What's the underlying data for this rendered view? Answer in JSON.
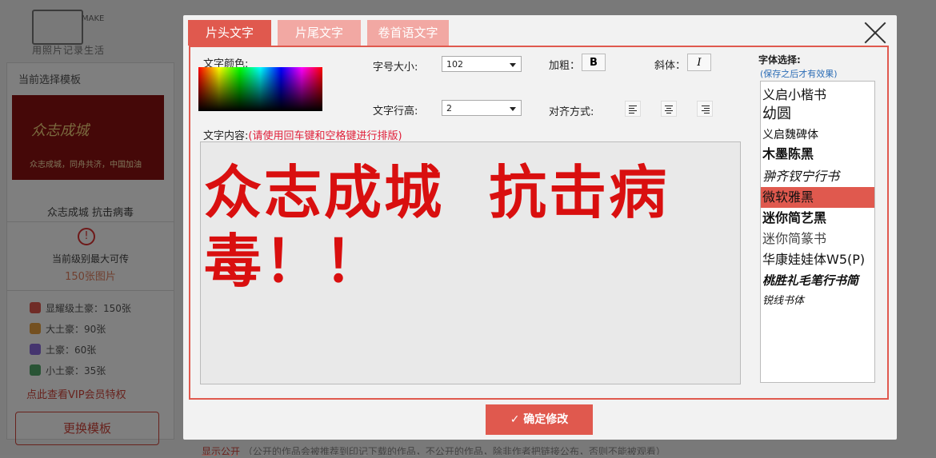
{
  "background": {
    "logo_make": "MAKE",
    "logo_sub": "用照片记录生活",
    "left_header": "当前选择模板",
    "thumb_title": "众志成城",
    "thumb_sub": "众志成城，同舟共济，中国加油",
    "template_name": "众志成城 抗击病毒",
    "warn_glyph": "!",
    "level_text": "当前级别最大可传",
    "count_text": "150张图片",
    "vip_items": [
      {
        "label": "显耀级土豪：150张",
        "color": "#e0594e"
      },
      {
        "label": "大土豪：90张",
        "color": "#e8a040"
      },
      {
        "label": "土豪：60张",
        "color": "#8a6adf"
      },
      {
        "label": "小土豪：35张",
        "color": "#52a86a"
      }
    ],
    "vip_link": "点此查看VIP会员特权",
    "change_button": "更换模板",
    "bottom_text": "显示公开",
    "bottom_note": "（公开的作品会被推荐到印记下载的作品，不公开的作品，除非作者把链接公布，否则不能被观看）"
  },
  "modal": {
    "tabs": [
      "片头文字",
      "片尾文字",
      "卷首语文字"
    ],
    "active_tab": 0,
    "text_color_label": "文字颜色:",
    "font_size_label": "字号大小:",
    "font_size_value": "102",
    "line_height_label": "文字行高:",
    "line_height_value": "2",
    "bold_label": "加粗：",
    "bold_button": "B",
    "italic_label": "斜体：",
    "italic_button": "I",
    "align_label": "对齐方式:",
    "content_label": "文字内容:",
    "content_hint": "(请使用回车键和空格键进行排版)",
    "content_value": "众志成城  抗击病毒！！",
    "content_color": "#d90f0f",
    "font_select_label": "字体选择:",
    "font_select_hint": "(保存之后才有效果)",
    "fonts": [
      "义启小楷书",
      "幼圆",
      "义启魏碑体",
      "木墨陈黑",
      "翀齐钗宁行书",
      "微软雅黑",
      "迷你简艺黑",
      "迷你简篆书",
      "华康娃娃体W5(P)",
      "桃胜礼毛笔行书简",
      "锐线书体"
    ],
    "selected_font": "微软雅黑",
    "confirm_button": "✓ 确定修改",
    "accent_color": "#e0594e"
  }
}
